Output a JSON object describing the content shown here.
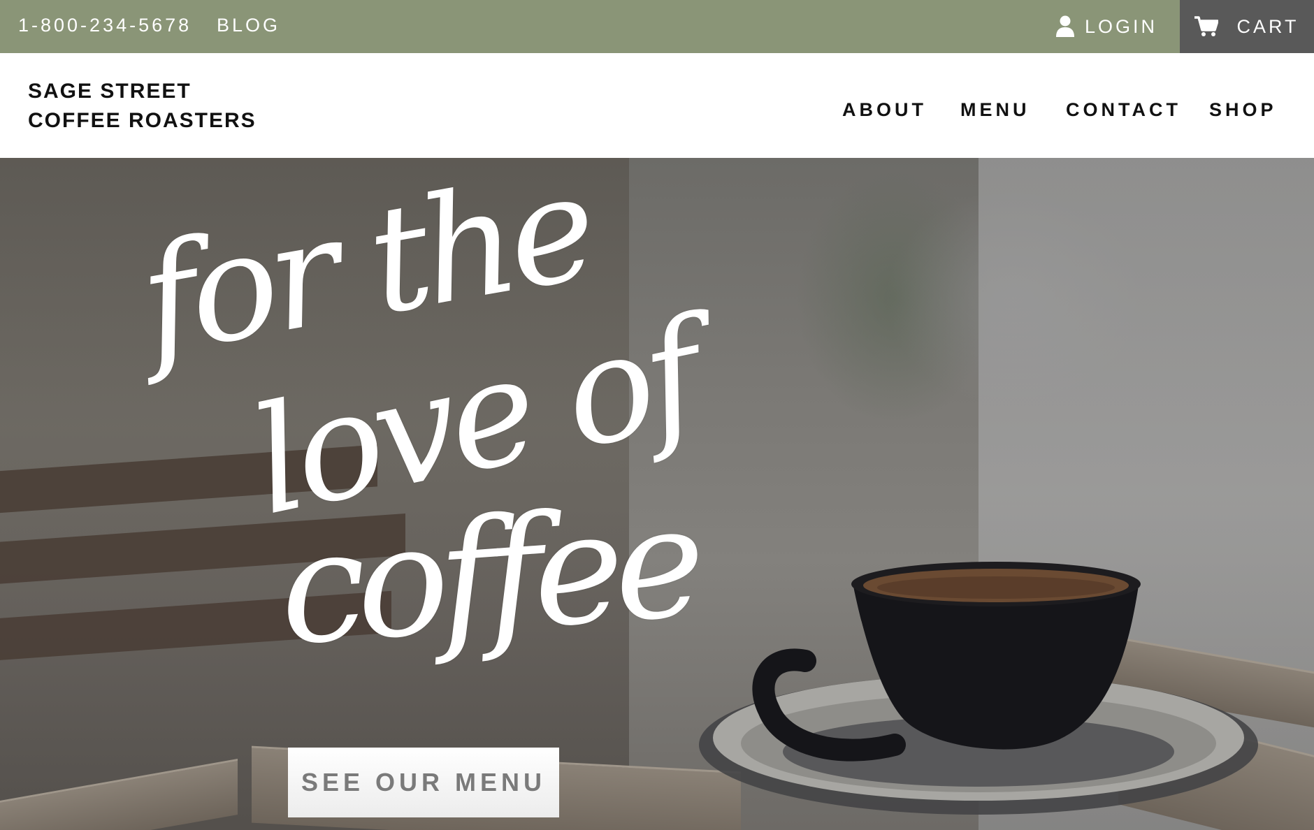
{
  "topbar": {
    "phone": "1-800-234-5678",
    "blog": "BLOG",
    "login": "LOGIN",
    "login_icon": "user-icon",
    "cart": "CART",
    "cart_icon": "cart-icon",
    "background_color": "#8a9577",
    "cart_background_color": "#595959"
  },
  "header": {
    "brand_line1": "SAGE STREET",
    "brand_line2": "COFFEE ROASTERS",
    "nav": [
      {
        "label": "ABOUT"
      },
      {
        "label": "MENU"
      },
      {
        "label": "CONTACT"
      },
      {
        "label": "SHOP"
      }
    ]
  },
  "hero": {
    "script_line1": "for the",
    "script_line2": "love of",
    "script_line3": "coffee",
    "cta_label": "SEE OUR MENU"
  }
}
